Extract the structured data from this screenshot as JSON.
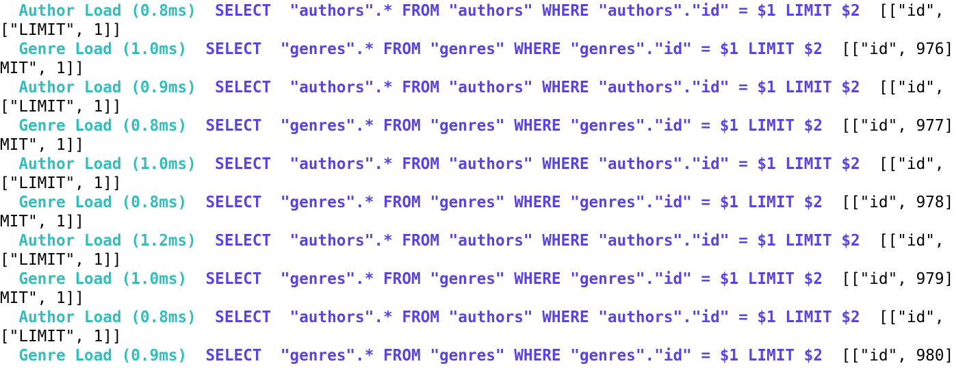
{
  "colors": {
    "background": "#ffffff",
    "load_label": "#35bcbc",
    "sql": "#5a44e0",
    "binds": "#000000"
  },
  "lines": [
    {
      "kind": "entry",
      "load": "  Author Load (0.8ms)  ",
      "sql": "SELECT  \"authors\".* FROM \"authors\" WHERE \"authors\".\"id\" = $1 LIMIT $2",
      "binds": "  [[\"id\","
    },
    {
      "kind": "wrap",
      "text": "[\"LIMIT\", 1]]"
    },
    {
      "kind": "entry",
      "load": "  Genre Load (1.0ms)  ",
      "sql": "SELECT  \"genres\".* FROM \"genres\" WHERE \"genres\".\"id\" = $1 LIMIT $2",
      "binds": "  [[\"id\", 976]"
    },
    {
      "kind": "wrap",
      "text": "MIT\", 1]]"
    },
    {
      "kind": "entry",
      "load": "  Author Load (0.9ms)  ",
      "sql": "SELECT  \"authors\".* FROM \"authors\" WHERE \"authors\".\"id\" = $1 LIMIT $2",
      "binds": "  [[\"id\","
    },
    {
      "kind": "wrap",
      "text": "[\"LIMIT\", 1]]"
    },
    {
      "kind": "entry",
      "load": "  Genre Load (0.8ms)  ",
      "sql": "SELECT  \"genres\".* FROM \"genres\" WHERE \"genres\".\"id\" = $1 LIMIT $2",
      "binds": "  [[\"id\", 977]"
    },
    {
      "kind": "wrap",
      "text": "MIT\", 1]]"
    },
    {
      "kind": "entry",
      "load": "  Author Load (1.0ms)  ",
      "sql": "SELECT  \"authors\".* FROM \"authors\" WHERE \"authors\".\"id\" = $1 LIMIT $2",
      "binds": "  [[\"id\","
    },
    {
      "kind": "wrap",
      "text": "[\"LIMIT\", 1]]"
    },
    {
      "kind": "entry",
      "load": "  Genre Load (0.8ms)  ",
      "sql": "SELECT  \"genres\".* FROM \"genres\" WHERE \"genres\".\"id\" = $1 LIMIT $2",
      "binds": "  [[\"id\", 978]"
    },
    {
      "kind": "wrap",
      "text": "MIT\", 1]]"
    },
    {
      "kind": "entry",
      "load": "  Author Load (1.2ms)  ",
      "sql": "SELECT  \"authors\".* FROM \"authors\" WHERE \"authors\".\"id\" = $1 LIMIT $2",
      "binds": "  [[\"id\","
    },
    {
      "kind": "wrap",
      "text": "[\"LIMIT\", 1]]"
    },
    {
      "kind": "entry",
      "load": "  Genre Load (1.0ms)  ",
      "sql": "SELECT  \"genres\".* FROM \"genres\" WHERE \"genres\".\"id\" = $1 LIMIT $2",
      "binds": "  [[\"id\", 979]"
    },
    {
      "kind": "wrap",
      "text": "MIT\", 1]]"
    },
    {
      "kind": "entry",
      "load": "  Author Load (0.8ms)  ",
      "sql": "SELECT  \"authors\".* FROM \"authors\" WHERE \"authors\".\"id\" = $1 LIMIT $2",
      "binds": "  [[\"id\","
    },
    {
      "kind": "wrap",
      "text": "[\"LIMIT\", 1]]"
    },
    {
      "kind": "entry",
      "load": "  Genre Load (0.9ms)  ",
      "sql": "SELECT  \"genres\".* FROM \"genres\" WHERE \"genres\".\"id\" = $1 LIMIT $2",
      "binds": "  [[\"id\", 980]"
    }
  ]
}
